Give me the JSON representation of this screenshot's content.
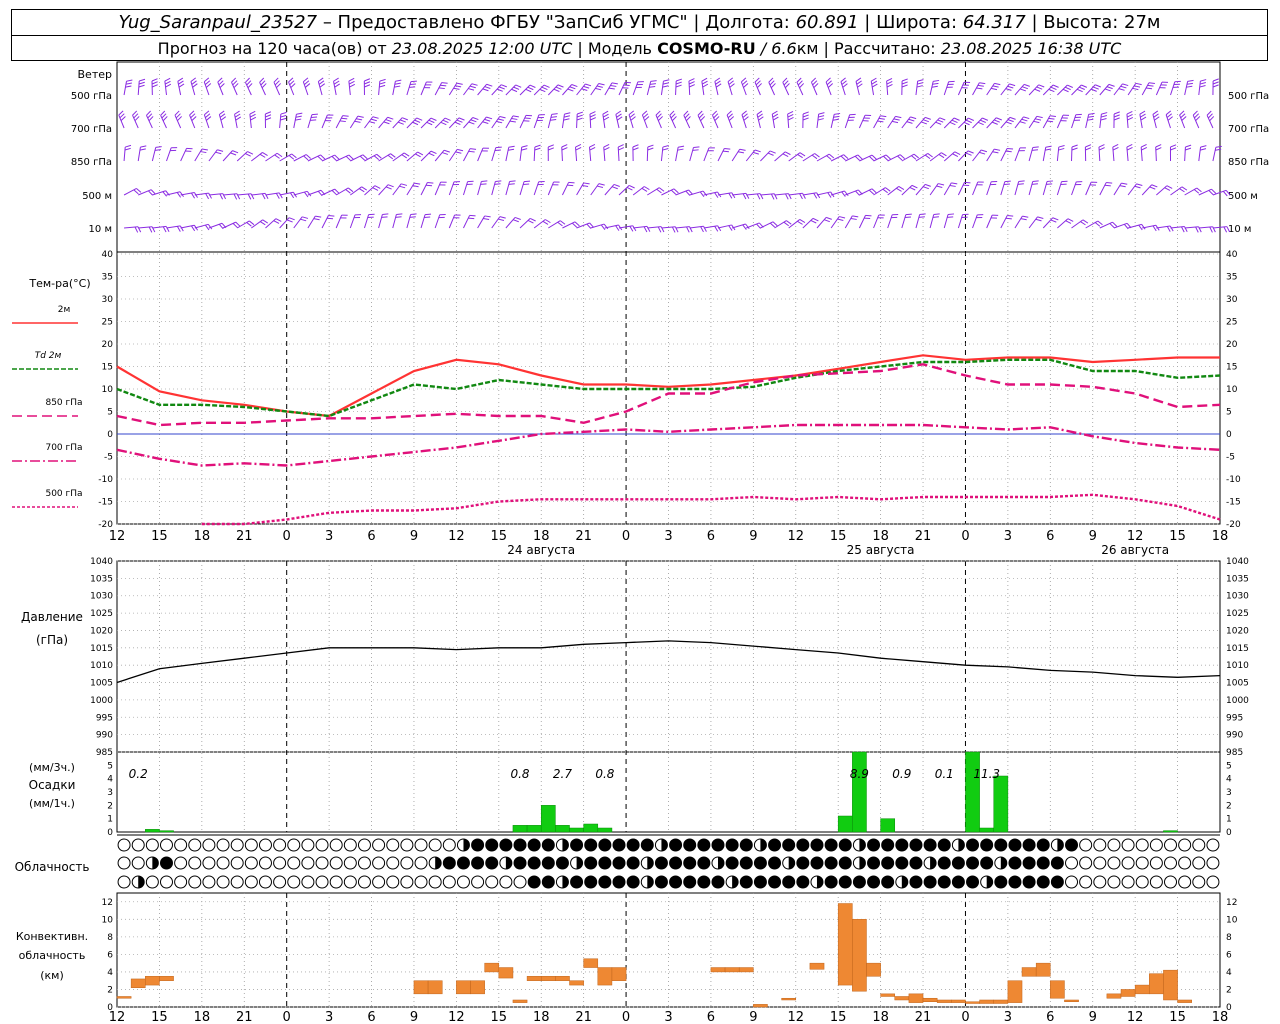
{
  "header": {
    "station": "Yug_Saranpaul_23527",
    "dash": " – ",
    "provider": "Предоставлено ФГБУ \"ЗапСиб УГМС\"",
    "sep": " | ",
    "lon_label": "Долгота: ",
    "lon": "60.891",
    "lat_label": "Широта: ",
    "lat": "64.317",
    "alt_label": "Высота: ",
    "alt": "27м",
    "forecast_pre": "Прогноз на 120 часа(ов) от ",
    "forecast_time": "23.08.2025 12:00 UTC",
    "model_pre": " | Модель ",
    "model": "COSMO-RU",
    "model_res": " / 6.6",
    "model_unit": "км",
    "calc_pre": " | Рассчитано: ",
    "calc_time": "23.08.2025 16:38 UTC"
  },
  "chart_data": [
    {
      "type": "wind_barbs",
      "title": "Ветер",
      "levels": [
        "500 гПа",
        "700 гПа",
        "850 гПа",
        "500 м",
        "10  м"
      ],
      "color": "#8a2be2"
    },
    {
      "type": "line",
      "ylabel": "Тем-ра(°С)",
      "ylim": [
        -20,
        40
      ],
      "yticks": [
        -20,
        -15,
        -10,
        -5,
        0,
        5,
        10,
        15,
        20,
        25,
        30,
        35,
        40
      ],
      "x": [
        0,
        3,
        6,
        9,
        12,
        15,
        18,
        21,
        24,
        27,
        30,
        33,
        36,
        39,
        42,
        45,
        48,
        51,
        54,
        57,
        60,
        63,
        66,
        69,
        72,
        75,
        78
      ],
      "series": [
        {
          "name": "2м",
          "color": "#ff3333",
          "dash": "solid",
          "values": [
            15,
            9.5,
            7.5,
            6.5,
            5,
            4,
            9,
            14,
            16.5,
            15.5,
            13,
            11,
            11,
            10.5,
            11,
            12,
            13,
            14.5,
            16,
            17.5,
            16.5,
            17,
            17,
            16,
            16.5,
            17,
            17
          ]
        },
        {
          "name": "Td  2м",
          "color": "#118811",
          "dash": "5 2",
          "values": [
            10,
            6.5,
            6.5,
            6,
            5,
            4,
            7.5,
            11,
            10,
            12,
            11,
            10,
            10,
            10,
            10,
            10.5,
            12.5,
            14,
            15,
            16,
            16,
            16.5,
            16.5,
            14,
            14,
            12.5,
            13
          ]
        },
        {
          "name": "850 гПа",
          "color": "#e0107a",
          "dash": "10 5",
          "values": [
            4,
            2,
            2.5,
            2.5,
            3,
            3.5,
            3.5,
            4,
            4.5,
            4,
            4,
            2.5,
            5,
            9,
            9,
            11.5,
            13,
            13.5,
            14,
            15.5,
            13,
            11,
            11,
            10.5,
            9,
            6,
            6.5
          ]
        },
        {
          "name": "700 гПа",
          "color": "#e0107a",
          "dash": "10 3 2 3",
          "values": [
            -3.5,
            -5.5,
            -7,
            -6.5,
            -7,
            -6,
            -5,
            -4,
            -3,
            -1.5,
            0,
            0.5,
            1,
            0.5,
            1,
            1.5,
            2,
            2,
            2,
            2,
            1.5,
            1,
            1.5,
            -0.5,
            -2,
            -3,
            -3.5
          ]
        },
        {
          "name": "500 гПа",
          "color": "#e0107a",
          "dash": "3 2",
          "values": [
            null,
            null,
            -20,
            -20,
            -19,
            -17.5,
            -17,
            -17,
            -16.5,
            -15,
            -14.5,
            -14.5,
            -14.5,
            -14.5,
            -14.5,
            -14,
            -14.5,
            -14,
            -14.5,
            -14,
            -14,
            -14,
            -14,
            -13.5,
            -14.5,
            -16,
            -19
          ]
        }
      ],
      "day_labels": [
        "24 августа",
        "25 августа",
        "26 августа"
      ]
    },
    {
      "type": "line",
      "ylabel": "Давление",
      "yunit": "(гПа)",
      "ylim": [
        985,
        1040
      ],
      "yticks": [
        985,
        990,
        995,
        1000,
        1005,
        1010,
        1015,
        1020,
        1025,
        1030,
        1035,
        1040
      ],
      "x": [
        0,
        3,
        6,
        9,
        12,
        15,
        18,
        21,
        24,
        27,
        30,
        33,
        36,
        39,
        42,
        45,
        48,
        51,
        54,
        57,
        60,
        63,
        66,
        69,
        72,
        75,
        78
      ],
      "values": [
        1005,
        1009,
        1010.5,
        1012,
        1013.5,
        1015,
        1015,
        1015,
        1014.5,
        1015,
        1015,
        1016,
        1016.5,
        1017,
        1016.5,
        1015.5,
        1014.5,
        1013.5,
        1012,
        1011,
        1010,
        1009.5,
        1008.5,
        1008,
        1007,
        1006.5,
        1007
      ]
    },
    {
      "type": "bar",
      "ylabel": "Осадки",
      "yunit_3h": "(мм/3ч.)",
      "yunit_1h": "(мм/1ч.)",
      "ylim": [
        0,
        6
      ],
      "yticks": [
        0,
        1,
        2,
        3,
        4,
        5
      ],
      "color": "#11cc11",
      "bars": [
        {
          "t": 2.5,
          "v": 0.2
        },
        {
          "t": 3.5,
          "v": 0.1
        },
        {
          "t": 28.5,
          "v": 0.5
        },
        {
          "t": 29.5,
          "v": 0.5
        },
        {
          "t": 30.5,
          "v": 2.0
        },
        {
          "t": 31.5,
          "v": 0.5
        },
        {
          "t": 32.5,
          "v": 0.3
        },
        {
          "t": 33.5,
          "v": 0.6
        },
        {
          "t": 34.5,
          "v": 0.3
        },
        {
          "t": 51.5,
          "v": 1.2
        },
        {
          "t": 52.5,
          "v": 6.0
        },
        {
          "t": 54.5,
          "v": 1.0
        },
        {
          "t": 60.5,
          "v": 6.0
        },
        {
          "t": 61.5,
          "v": 0.3
        },
        {
          "t": 62.5,
          "v": 4.2
        },
        {
          "t": 74.5,
          "v": 0.1
        }
      ],
      "annotations": [
        {
          "t": 1.5,
          "text": "0.2"
        },
        {
          "t": 28.5,
          "text": "0.8"
        },
        {
          "t": 31.5,
          "text": "2.7"
        },
        {
          "t": 34.5,
          "text": "0.8"
        },
        {
          "t": 52.5,
          "text": "8.9"
        },
        {
          "t": 55.5,
          "text": "0.9"
        },
        {
          "t": 58.5,
          "text": "0.1"
        },
        {
          "t": 61.5,
          "text": "11.3"
        }
      ]
    },
    {
      "type": "symbols",
      "ylabel": "Облачность",
      "rows": 3
    },
    {
      "type": "bar",
      "ylabel": "Конвективн.",
      "ylabel2": "облачность",
      "yunit": "(км)",
      "ylim": [
        0,
        13
      ],
      "yticks": [
        0,
        2,
        4,
        6,
        8,
        10,
        12
      ],
      "color": "#ee8833",
      "bars": [
        {
          "t": 0.5,
          "b": 1,
          "v": 1.2
        },
        {
          "t": 1.5,
          "b": 2.2,
          "v": 3.2
        },
        {
          "t": 2.5,
          "b": 2.5,
          "v": 3.5
        },
        {
          "t": 3.5,
          "b": 3,
          "v": 3.5
        },
        {
          "t": 21.5,
          "b": 1.5,
          "v": 3.0
        },
        {
          "t": 22.5,
          "b": 1.5,
          "v": 3.0
        },
        {
          "t": 24.5,
          "b": 1.5,
          "v": 3.0
        },
        {
          "t": 25.5,
          "b": 1.5,
          "v": 3.0
        },
        {
          "t": 26.5,
          "b": 4,
          "v": 5.0
        },
        {
          "t": 27.5,
          "b": 3.3,
          "v": 4.5
        },
        {
          "t": 28.5,
          "b": 0.5,
          "v": 0.8
        },
        {
          "t": 29.5,
          "b": 3,
          "v": 3.5
        },
        {
          "t": 30.5,
          "b": 3,
          "v": 3.5
        },
        {
          "t": 31.5,
          "b": 3,
          "v": 3.5
        },
        {
          "t": 32.5,
          "b": 2.5,
          "v": 3.0
        },
        {
          "t": 33.5,
          "b": 4.5,
          "v": 5.5
        },
        {
          "t": 34.5,
          "b": 2.5,
          "v": 4.5
        },
        {
          "t": 35.5,
          "b": 3,
          "v": 4.5
        },
        {
          "t": 42.5,
          "b": 4,
          "v": 4.5
        },
        {
          "t": 43.5,
          "b": 4,
          "v": 4.5
        },
        {
          "t": 44.5,
          "b": 4,
          "v": 4.5
        },
        {
          "t": 45.5,
          "b": 0,
          "v": 0.3
        },
        {
          "t": 47.5,
          "b": 0.8,
          "v": 1.0
        },
        {
          "t": 49.5,
          "b": 4.3,
          "v": 5.0
        },
        {
          "t": 51.5,
          "b": 2.5,
          "v": 11.8
        },
        {
          "t": 52.5,
          "b": 1.8,
          "v": 10.0
        },
        {
          "t": 53.5,
          "b": 3.5,
          "v": 5.0
        },
        {
          "t": 54.5,
          "b": 1.2,
          "v": 1.5
        },
        {
          "t": 55.5,
          "b": 0.8,
          "v": 1.2
        },
        {
          "t": 56.5,
          "b": 0.5,
          "v": 1.5
        },
        {
          "t": 57.5,
          "b": 0.6,
          "v": 1.0
        },
        {
          "t": 58.5,
          "b": 0.5,
          "v": 0.8
        },
        {
          "t": 59.5,
          "b": 0.5,
          "v": 0.8
        },
        {
          "t": 60.5,
          "b": 0.4,
          "v": 0.6
        },
        {
          "t": 61.5,
          "b": 0.4,
          "v": 0.8
        },
        {
          "t": 62.5,
          "b": 0.4,
          "v": 0.8
        },
        {
          "t": 63.5,
          "b": 0.5,
          "v": 3.0
        },
        {
          "t": 64.5,
          "b": 3.5,
          "v": 4.5
        },
        {
          "t": 65.5,
          "b": 3.5,
          "v": 5.0
        },
        {
          "t": 66.5,
          "b": 1,
          "v": 3.0
        },
        {
          "t": 67.5,
          "b": 0.6,
          "v": 0.8
        },
        {
          "t": 70.5,
          "b": 1,
          "v": 1.5
        },
        {
          "t": 71.5,
          "b": 1.2,
          "v": 2.0
        },
        {
          "t": 72.5,
          "b": 1.5,
          "v": 2.5
        },
        {
          "t": 73.5,
          "b": 1.5,
          "v": 3.8
        },
        {
          "t": 74.5,
          "b": 0.8,
          "v": 4.2
        },
        {
          "t": 75.5,
          "b": 0.5,
          "v": 0.8
        }
      ]
    }
  ],
  "x_axis": {
    "tick_labels": [
      "12",
      "15",
      "18",
      "21",
      "0",
      "3",
      "6",
      "9",
      "12",
      "15",
      "18",
      "21",
      "0",
      "3",
      "6",
      "9",
      "12",
      "15",
      "18",
      "21",
      "0",
      "3",
      "6",
      "9",
      "12",
      "15",
      "18"
    ]
  }
}
